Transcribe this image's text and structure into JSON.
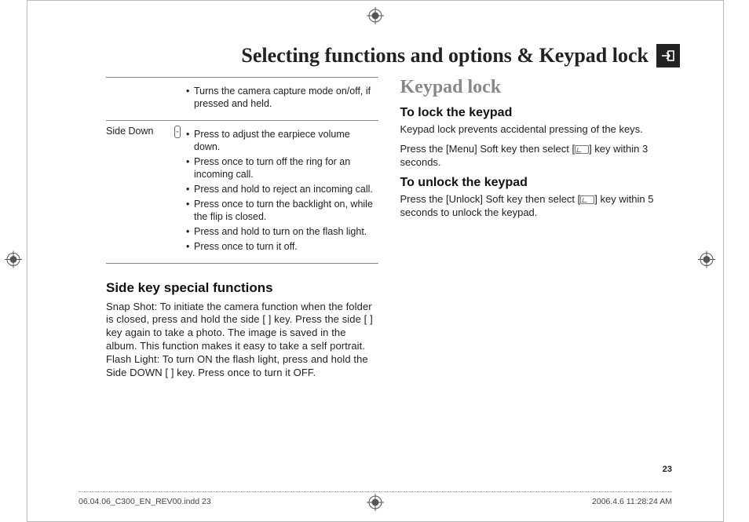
{
  "title": "Selecting functions and options & Keypad lock",
  "page_number": "23",
  "footer_left": "06.04.06_C300_EN_REV00.indd   23",
  "footer_right": "2006.4.6   11:28:24 AM",
  "table": {
    "row1": {
      "b1": "Turns the camera capture mode on/off, if pressed and held."
    },
    "row2": {
      "label": "Side Down",
      "b1": "Press to adjust the earpiece volume down.",
      "b2": "Press once to turn off the ring for an incoming call.",
      "b3": "Press and hold to reject an incoming call.",
      "b4": "Press once to turn the backlight on, while the flip is closed.",
      "b5": "Press and hold to turn on the flash light.",
      "b6": "Press once to turn it off."
    }
  },
  "left": {
    "heading": "Side key special functions",
    "para": "Snap Shot: To initiate the camera function when the folder is closed, press and hold the side [ ] key. Press the side [ ] key again to take a photo. The image is saved in the album. This function makes it easy to take a self portrait. Flash Light: To turn ON the flash light, press and hold the Side DOWN [ ] key. Press once to turn it OFF."
  },
  "right": {
    "heading": "Keypad lock",
    "sub1": "To lock the keypad",
    "p1": "Keypad lock prevents accidental pressing of the keys.",
    "p2a": "Press the [Menu] Soft key then select [",
    "p2b": "] key within 3 seconds.",
    "sub2": "To unlock the keypad",
    "p3a": "Press the [Unlock] Soft key then select [",
    "p3b": "] key within 5 seconds to unlock the keypad."
  }
}
